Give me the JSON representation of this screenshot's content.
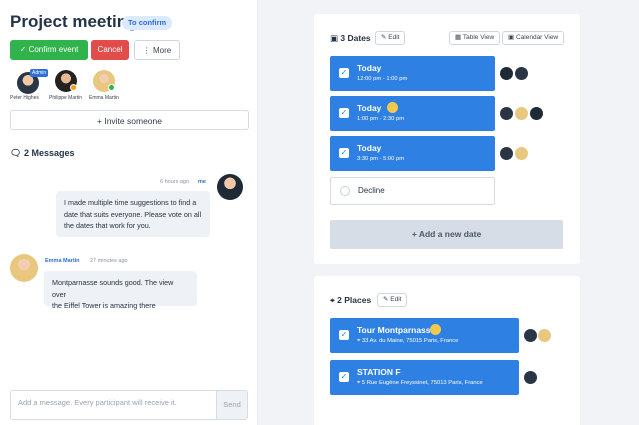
{
  "event": {
    "title": "Project meeting",
    "status": "To confirm"
  },
  "toolbar": {
    "confirm": "Confirm event",
    "cancel": "Cancel",
    "more": "More"
  },
  "participants": [
    {
      "name": "Peter Highes",
      "admin": "Admin"
    },
    {
      "name": "Philippe Martin"
    },
    {
      "name": "Emma Martin"
    }
  ],
  "invite": {
    "label": "Invite someone"
  },
  "messages": {
    "header": "2 Messages",
    "items": [
      {
        "time": "6 hours ago",
        "author": "me",
        "text_lines": [
          "I made multiple time suggestions to find a",
          "date that suits everyone. Please vote on all",
          "the dates that work for you."
        ]
      },
      {
        "author": "Emma Martin",
        "time": "27 minutes ago",
        "text_lines": [
          "Montparnasse sounds good. The view over",
          "the Eiffel Tower is amazing there"
        ]
      }
    ]
  },
  "compose": {
    "placeholder": "Add a message. Every participant will receive it.",
    "send": "Send"
  },
  "dates": {
    "header": "3 Dates",
    "edit": "Edit",
    "table_view": "Table View",
    "calendar_view": "Calendar View",
    "options": [
      {
        "label": "Today",
        "time": "12:00 pm - 1:00 pm"
      },
      {
        "label": "Today",
        "time": "1:00 pm - 2:30 pm"
      },
      {
        "label": "Today",
        "time": "3:30 pm - 5:00 pm"
      }
    ],
    "decline": "Decline",
    "add": "Add a new date"
  },
  "places": {
    "header": "2 Places",
    "edit": "Edit",
    "options": [
      {
        "label": "Tour Montparnasse",
        "address": "33 Av. du Maine, 75015 Paris, France"
      },
      {
        "label": "STATION F",
        "address": "5 Rue Eugène Freyssinet, 75013 Paris, France"
      }
    ]
  },
  "colors": {
    "primary": "#2f80e3",
    "success": "#2fb34a",
    "danger": "#e24c4b"
  }
}
